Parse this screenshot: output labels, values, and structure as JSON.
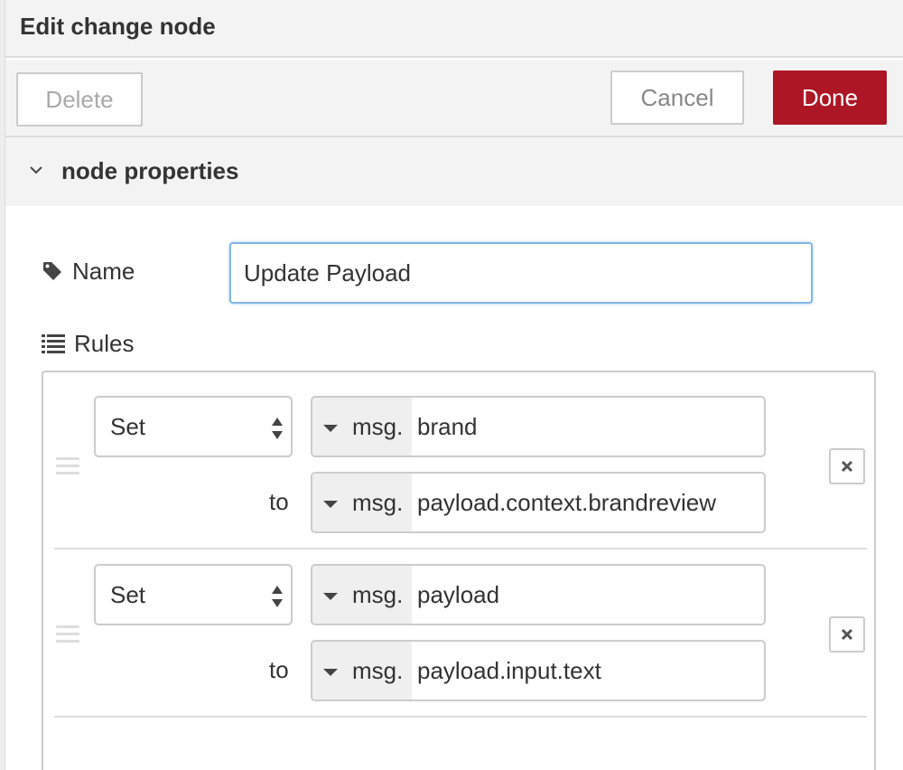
{
  "dialog": {
    "title": "Edit change node"
  },
  "toolbar": {
    "delete_label": "Delete",
    "cancel_label": "Cancel",
    "done_label": "Done"
  },
  "section": {
    "label": "node properties"
  },
  "name_field": {
    "label": "Name",
    "value": "Update Payload",
    "icon": "tag-icon"
  },
  "rules_field": {
    "label": "Rules",
    "icon": "list-icon"
  },
  "rules": [
    {
      "action": "Set",
      "to_label": "to",
      "target": {
        "type": "msg.",
        "value": "brand"
      },
      "source": {
        "type": "msg.",
        "value": "payload.context.brandreview"
      }
    },
    {
      "action": "Set",
      "to_label": "to",
      "target": {
        "type": "msg.",
        "value": "payload"
      },
      "source": {
        "type": "msg.",
        "value": "payload.input.text"
      }
    }
  ],
  "colors": {
    "done_button": "#ad1625",
    "focus_border": "#85b7e8"
  }
}
